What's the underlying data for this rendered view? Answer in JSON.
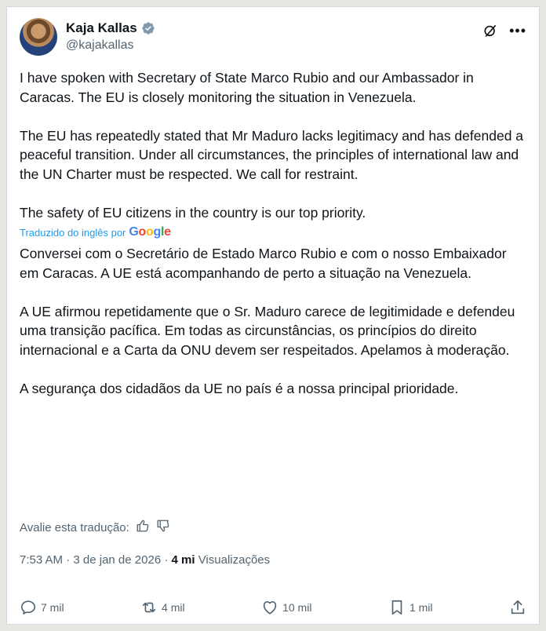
{
  "author": {
    "name": "Kaja Kallas",
    "handle": "@kajakallas"
  },
  "tweet": {
    "paragraphs": [
      "I have spoken with Secretary of State Marco Rubio and our Ambassador in Caracas. The EU is closely monitoring the situation in Venezuela.",
      "The EU has repeatedly stated that Mr Maduro lacks legitimacy and has defended a peaceful transition. Under all circumstances, the principles of international law and the UN Charter must be respected. We call for restraint.",
      "The safety of EU citizens in the country is our top priority."
    ]
  },
  "translation": {
    "label": "Traduzido do inglês por",
    "provider": "Google",
    "paragraphs": [
      "Conversei com o Secretário de Estado Marco Rubio e com o nosso Embaixador em Caracas. A UE está acompanhando de perto a situação na Venezuela.",
      "A UE afirmou repetidamente que o Sr. Maduro carece de legitimidade e defendeu uma transição pacífica. Em todas as circunstâncias, os princípios do direito internacional e a Carta da ONU devem ser respeitados. Apelamos à moderação.",
      "A segurança dos cidadãos da UE no país é a nossa principal prioridade."
    ],
    "rate_label": "Avalie esta tradução:"
  },
  "meta": {
    "time": "7:53 AM",
    "separator": "·",
    "date": "3 de jan de 2026",
    "views_count": "4 mi",
    "views_label": "Visualizações"
  },
  "actions": {
    "replies": "7 mil",
    "reposts": "4 mil",
    "likes": "10 mil",
    "bookmarks": "1 mil"
  },
  "colors": {
    "verified": "#829aab",
    "link": "#1d9bf0",
    "muted": "#536471",
    "text": "#0f1419"
  }
}
